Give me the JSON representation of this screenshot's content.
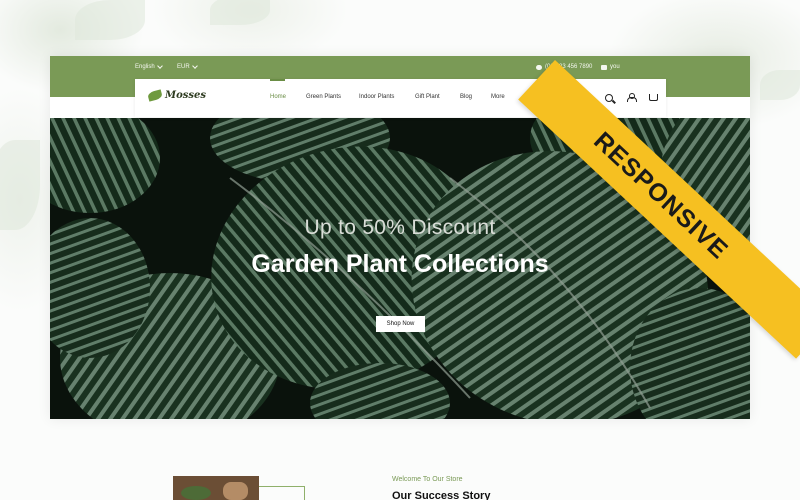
{
  "topbar": {
    "language": "English",
    "currency": "EUR",
    "phone": "(08)123 456 7890",
    "email": "you"
  },
  "brand": {
    "name": "Mosses"
  },
  "nav": {
    "items": [
      {
        "label": "Home",
        "active": true
      },
      {
        "label": "Green Plants",
        "active": false
      },
      {
        "label": "Indoor Plants",
        "active": false
      },
      {
        "label": "Gift Plant",
        "active": false
      },
      {
        "label": "Blog",
        "active": false
      },
      {
        "label": "More",
        "active": false
      }
    ],
    "icons": [
      "search-icon",
      "user-icon",
      "cart-icon"
    ]
  },
  "hero": {
    "subtitle": "Up to 50% Discount",
    "title": "Garden Plant Collections",
    "button_label": "Shop Now"
  },
  "about": {
    "eyebrow": "Welcome To Our Store",
    "heading": "Our Success Story"
  },
  "ribbon": {
    "label": "RESPONSIVE"
  },
  "colors": {
    "accent_green": "#7a9a56",
    "ribbon_yellow": "#f6c021",
    "hero_dark": "#0f1a12"
  }
}
